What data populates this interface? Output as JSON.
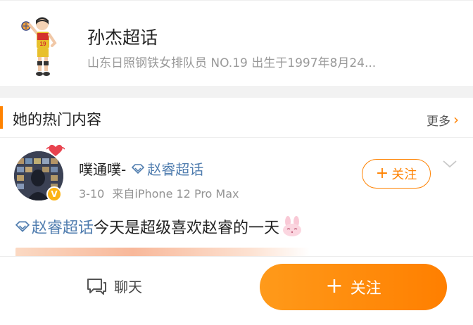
{
  "topic": {
    "title": "孙杰超话",
    "description": "山东日照钢铁女排队员 NO.19 出生于1997年8月24...",
    "avatar_icon": "volleyball-player-illustration"
  },
  "section": {
    "title": "她的热门内容",
    "more_label": "更多",
    "accent": "#ff8200"
  },
  "post": {
    "author": "噗通噗-",
    "author_topic": "赵睿超话",
    "timestamp": "3-10",
    "source": "来自iPhone 12 Pro Max",
    "follow_label": "关注",
    "text_topic": "赵睿超话",
    "text_body": "今天是超级喜欢赵睿的一天",
    "badge": "V",
    "icons": [
      "heart-badge-icon",
      "diamond-icon",
      "bunny-emoji-icon",
      "chevron-down-icon"
    ]
  },
  "bottom": {
    "chat_label": "聊天",
    "follow_label": "关注",
    "follow_color": "#ff8200"
  }
}
